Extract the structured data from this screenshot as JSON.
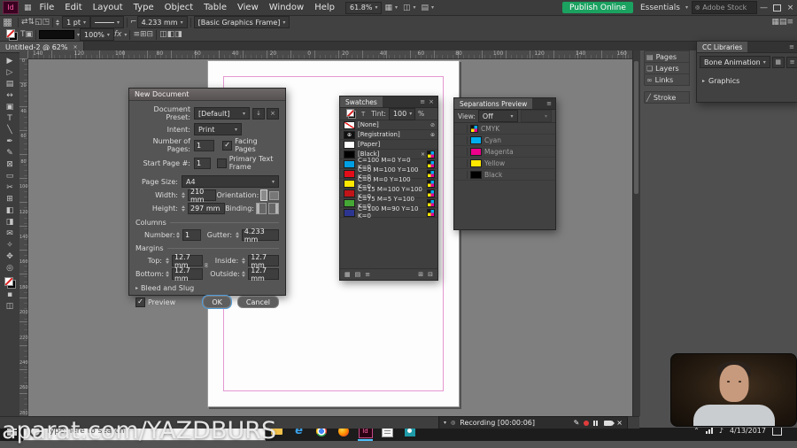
{
  "icons": {
    "chevron_down": "▾",
    "chevron_right": "▸",
    "menu": "≡",
    "close": "×",
    "minimize": "—",
    "search": "◎",
    "check": "✓",
    "pencil": "✎",
    "slash": "⊘",
    "target": "⊕",
    "stack": "▦",
    "monitor": "◫",
    "doc": "▤",
    "plus_box": "⊞",
    "minus_box": "⊟",
    "down": "↓",
    "link": "∞",
    "note": "♪",
    "chevron_up": "⌃"
  },
  "menubar": {
    "logo": "Id",
    "menus": [
      "File",
      "Edit",
      "Layout",
      "Type",
      "Object",
      "Table",
      "View",
      "Window",
      "Help"
    ],
    "zoom": "61.8%",
    "publish_button": "Publish Online",
    "workspace": "Essentials",
    "stock_search": "Adobe Stock"
  },
  "controlbar": {
    "stroke_weight": "1 pt",
    "corner_radius": "4.233 mm",
    "object_style": "[Basic Graphics Frame]",
    "opacity": "100%",
    "effects": "fx"
  },
  "tabbar": {
    "doc_title": "Untitled-2 @ 62%"
  },
  "tools": [
    {
      "name": "selection-tool",
      "glyph": "▶"
    },
    {
      "name": "direct-selection-tool",
      "glyph": "▷"
    },
    {
      "name": "page-tool",
      "glyph": "▤"
    },
    {
      "name": "gap-tool",
      "glyph": "↔"
    },
    {
      "name": "content-collector-tool",
      "glyph": "▣"
    },
    {
      "name": "type-tool",
      "glyph": "T"
    },
    {
      "name": "line-tool",
      "glyph": "╲"
    },
    {
      "name": "pen-tool",
      "glyph": "✒"
    },
    {
      "name": "pencil-tool",
      "glyph": "✎"
    },
    {
      "name": "rectangle-frame-tool",
      "glyph": "⊠"
    },
    {
      "name": "rectangle-tool",
      "glyph": "▭"
    },
    {
      "name": "scissors-tool",
      "glyph": "✂"
    },
    {
      "name": "free-transform-tool",
      "glyph": "⊞"
    },
    {
      "name": "gradient-swatch-tool",
      "glyph": "◧"
    },
    {
      "name": "gradient-feather-tool",
      "glyph": "◨"
    },
    {
      "name": "note-tool",
      "glyph": "✉"
    },
    {
      "name": "eyedropper-tool",
      "glyph": "✧"
    },
    {
      "name": "hand-tool",
      "glyph": "✥"
    },
    {
      "name": "zoom-tool",
      "glyph": "◎"
    }
  ],
  "tools_extra": [
    {
      "name": "default-colors-icon",
      "glyph": "▪"
    },
    {
      "name": "screen-mode-icon",
      "glyph": "◫"
    }
  ],
  "ruler": {
    "h": [
      "140",
      "120",
      "100",
      "80",
      "60",
      "40",
      "20",
      "0",
      "20",
      "40",
      "60",
      "80",
      "100",
      "120",
      "140",
      "160"
    ],
    "v": [
      "0",
      "20",
      "40",
      "60",
      "80",
      "100",
      "120",
      "140",
      "160",
      "180",
      "200",
      "220",
      "240",
      "260",
      "280"
    ]
  },
  "dialog": {
    "title": "New Document",
    "preset_label": "Document Preset:",
    "preset_value": "[Default]",
    "intent_label": "Intent:",
    "intent_value": "Print",
    "pages_label": "Number of Pages:",
    "pages_value": "1",
    "facing_pages": "Facing Pages",
    "start_label": "Start Page #:",
    "start_value": "1",
    "primary_text": "Primary Text Frame",
    "page_size_label": "Page Size:",
    "page_size_value": "A4",
    "width_label": "Width:",
    "width_value": "210 mm",
    "height_label": "Height:",
    "height_value": "297 mm",
    "orientation_label": "Orientation:",
    "binding_label": "Binding:",
    "columns_label": "Columns",
    "number_label": "Number:",
    "number_value": "1",
    "gutter_label": "Gutter:",
    "gutter_value": "4.233 mm",
    "margins_label": "Margins",
    "top_label": "Top:",
    "top_value": "12.7 mm",
    "bottom_label": "Bottom:",
    "bottom_value": "12.7 mm",
    "inside_label": "Inside:",
    "inside_value": "12.7 mm",
    "outside_label": "Outside:",
    "outside_value": "12.7 mm",
    "bleed_label": "Bleed and Slug",
    "preview_label": "Preview",
    "ok": "OK",
    "cancel": "Cancel"
  },
  "swatches": {
    "title": "Swatches",
    "tint_label": "Tint:",
    "tint_value": "100",
    "tint_unit": "%",
    "items": [
      {
        "name": "[None]",
        "color": "#ffffff"
      },
      {
        "name": "[Registration]",
        "color": "#111111"
      },
      {
        "name": "[Paper]",
        "color": "#ffffff"
      },
      {
        "name": "[Black]",
        "color": "#000000"
      },
      {
        "name": "C=100 M=0 Y=0 K=0",
        "color": "#009fe3"
      },
      {
        "name": "C=0 M=100 Y=100 K=0",
        "color": "#e30d1a"
      },
      {
        "name": "C=0 M=0 Y=100 K=0",
        "color": "#ffe800"
      },
      {
        "name": "C=15 M=100 Y=100 K=0",
        "color": "#c01419"
      },
      {
        "name": "C=75 M=5 Y=100 K=0",
        "color": "#45a735"
      },
      {
        "name": "C=100 M=90 Y=10 K=0",
        "color": "#2c3690"
      }
    ]
  },
  "separations": {
    "title": "Separations Preview",
    "view_label": "View:",
    "view_value": "Off",
    "items": [
      {
        "name": "CMYK",
        "color": ""
      },
      {
        "name": "Cyan",
        "color": "#00aeef"
      },
      {
        "name": "Magenta",
        "color": "#ec008c"
      },
      {
        "name": "Yellow",
        "color": "#ffe800"
      },
      {
        "name": "Black",
        "color": "#000000"
      }
    ]
  },
  "dock": {
    "buttons": [
      {
        "label": "Pages",
        "glyph": "▤"
      },
      {
        "label": "Layers",
        "glyph": "❏"
      },
      {
        "label": "Links",
        "glyph": "∞"
      },
      {
        "label": "Stroke",
        "glyph": "╱"
      }
    ]
  },
  "cclib": {
    "title": "CC Libraries",
    "library": "Bone Animation",
    "item": "Graphics"
  },
  "recording": {
    "label": "Recording [00:00:06]"
  },
  "watermark": "aparat.com/YAZDBURS",
  "taskbar": {
    "search": "Type here to search",
    "date": "4/13/2017"
  },
  "colors": {
    "publish_button": "#1ba160",
    "taskbar_active": "#4cc2ff"
  }
}
